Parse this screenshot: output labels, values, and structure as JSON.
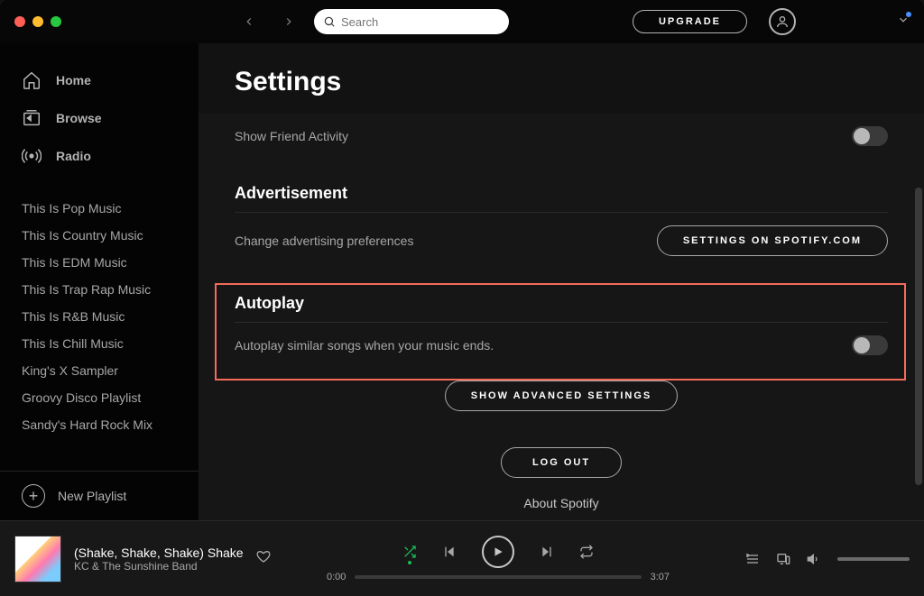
{
  "topbar": {
    "search_placeholder": "Search",
    "upgrade_label": "UPGRADE"
  },
  "sidebar": {
    "main_items": [
      {
        "label": "Home"
      },
      {
        "label": "Browse"
      },
      {
        "label": "Radio"
      }
    ],
    "playlists": [
      "This Is Pop Music",
      "This Is Country Music",
      "This Is EDM Music",
      "This Is Trap Rap Music",
      "This Is R&B Music",
      "This Is Chill Music",
      "King's X Sampler",
      "Groovy Disco Playlist",
      "Sandy's Hard Rock Mix"
    ],
    "new_playlist_label": "New Playlist"
  },
  "settings": {
    "title": "Settings",
    "friend_activity_label": "Show Friend Activity",
    "advertisement_heading": "Advertisement",
    "advertisement_desc": "Change advertising preferences",
    "advertisement_button": "SETTINGS ON SPOTIFY.COM",
    "autoplay_heading": "Autoplay",
    "autoplay_desc": "Autoplay similar songs when your music ends.",
    "show_advanced_label": "SHOW ADVANCED SETTINGS",
    "logout_label": "LOG OUT",
    "about_label": "About Spotify"
  },
  "player": {
    "track_title": "(Shake, Shake, Shake) Shake",
    "track_artist": "KC & The Sunshine Band",
    "elapsed": "0:00",
    "duration": "3:07"
  }
}
